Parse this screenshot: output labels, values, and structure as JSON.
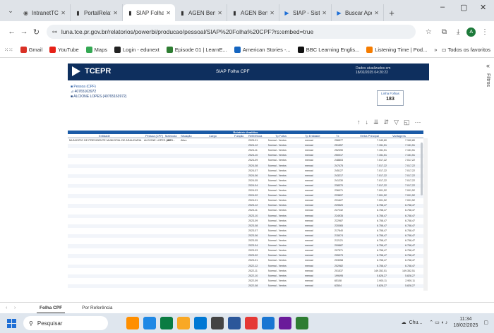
{
  "browser": {
    "tabs": [
      {
        "title": "IntranetTC",
        "icon": "globe-icon",
        "active": false
      },
      {
        "title": "PortalRelatório",
        "icon": "powerbi-icon",
        "active": false
      },
      {
        "title": "SIAP Folha CPF",
        "icon": "powerbi-icon",
        "active": true
      },
      {
        "title": "AGEN Benefício",
        "icon": "powerbi-icon",
        "active": false
      },
      {
        "title": "AGEN Benefício",
        "icon": "powerbi-icon",
        "active": false
      },
      {
        "title": "SIAP - Sistema",
        "icon": "play-icon",
        "active": false
      },
      {
        "title": "Buscar Aposent",
        "icon": "play-icon",
        "active": false
      }
    ],
    "window_controls": {
      "minimize": "–",
      "maximize": "▢",
      "close": "✕"
    },
    "url": "luna.tce.pr.gov.br/relatorios/powerbi/producao/pessoal/SIAP%20Folha%20CPF?rs:embed=true",
    "bookmarks": [
      {
        "label": "Gmail",
        "color": "#d93025"
      },
      {
        "label": "YouTube",
        "color": "#e62117"
      },
      {
        "label": "Maps",
        "color": "#34a853"
      },
      {
        "label": "Login - edunext",
        "color": "#222"
      },
      {
        "label": "Episode 01 | LearnE...",
        "color": "#2e7d32"
      },
      {
        "label": "American Stories -...",
        "color": "#1565c0"
      },
      {
        "label": "BBC Learning Englis...",
        "color": "#111"
      },
      {
        "label": "Listening Time | Pod...",
        "color": "#f57c00"
      }
    ],
    "bookmarks_more": "»",
    "bookmarks_folder": "Todos os favoritos"
  },
  "report": {
    "brand": "TCEPR",
    "title": "SIAP Folha CPF",
    "updated_label": "Dados atualizados em",
    "updated_at": "18/02/2025 04:20:22",
    "filter_pessoa_label": "■ Pessoa (CPF)",
    "filter_cpf_line": "⊿ 40765163972",
    "filter_name_line": "■ ALCIONE LOPES (40765163972)",
    "cpf_box_caption": "Linha Folhas",
    "cpf_box_value": "183",
    "visual_tools": [
      "↑",
      "↓",
      "⇊",
      "⇵",
      "▽",
      "◱",
      "⋯"
    ],
    "table_title": "Relatório Analítico",
    "columns": {
      "entidade": "Entidade",
      "pessoa": "Pessoa (CPF)",
      "matricula": "Matrícula",
      "situacao": "Situação",
      "cargo": "Cargo",
      "funcao": "Função",
      "referencia": "Referência",
      "tipo_folha": "Tp Folha",
      "tipo_entidade": "Tp Entidade",
      "id": "Tx",
      "bruto": "Verba Principal",
      "vantagens": "Vantagens"
    },
    "first_row": {
      "entidade": "MUNICIPIO DE PRESIDENTE MUNICIPAL DE ARAUCARIA",
      "pessoa": "ALCIONE LOPES (4076...",
      "matricula": "153",
      "situacao": "Ativo"
    },
    "rows": [
      {
        "ref": "2025-01",
        "tipo": "Normal - Ventos",
        "tent": "mensal",
        "id": "256577",
        "v1": "7.340,80",
        "v2": "7.340,80"
      },
      {
        "ref": "2024-12",
        "tipo": "Normal - Ventos",
        "tent": "mensal",
        "id": "251557",
        "v1": "7.151,51",
        "v2": "7.151,51"
      },
      {
        "ref": "2024-11",
        "tipo": "Normal - Ventos",
        "tent": "mensal",
        "id": "252390",
        "v1": "7.151,51",
        "v2": "7.151,51"
      },
      {
        "ref": "2024-10",
        "tipo": "Normal - Ventos",
        "tent": "mensal",
        "id": "250017",
        "v1": "7.151,51",
        "v2": "7.151,51"
      },
      {
        "ref": "2024-09",
        "tipo": "Normal - Ventos",
        "tent": "mensal",
        "id": "248803",
        "v1": "7.017,22",
        "v2": "7.017,22"
      },
      {
        "ref": "2024-08",
        "tipo": "Normal - Ventos",
        "tent": "mensal",
        "id": "247475",
        "v1": "7.017,22",
        "v2": "7.017,22"
      },
      {
        "ref": "2024-07",
        "tipo": "Normal - Ventos",
        "tent": "mensal",
        "id": "245127",
        "v1": "7.017,22",
        "v2": "7.017,22"
      },
      {
        "ref": "2024-06",
        "tipo": "Normal - Ventos",
        "tent": "mensal",
        "id": "243217",
        "v1": "7.017,22",
        "v2": "7.017,22"
      },
      {
        "ref": "2024-05",
        "tipo": "Normal - Ventos",
        "tent": "mensal",
        "id": "241230",
        "v1": "7.017,22",
        "v2": "7.017,22"
      },
      {
        "ref": "2024-04",
        "tipo": "Normal - Ventos",
        "tent": "mensal",
        "id": "238370",
        "v1": "7.017,22",
        "v2": "7.017,22"
      },
      {
        "ref": "2024-03",
        "tipo": "Normal - Ventos",
        "tent": "mensal",
        "id": "236071",
        "v1": "7.001,52",
        "v2": "7.001,52"
      },
      {
        "ref": "2024-02",
        "tipo": "Normal - Ventos",
        "tent": "mensal",
        "id": "233897",
        "v1": "7.001,52",
        "v2": "7.001,52"
      },
      {
        "ref": "2024-01",
        "tipo": "Normal - Ventos",
        "tent": "mensal",
        "id": "231627",
        "v1": "7.001,52",
        "v2": "7.001,52"
      },
      {
        "ref": "2023-12",
        "tipo": "Normal - Ventos",
        "tent": "mensal",
        "id": "229520",
        "v1": "6.758,47",
        "v2": "6.758,47"
      },
      {
        "ref": "2023-11",
        "tipo": "Normal - Ventos",
        "tent": "mensal",
        "id": "227232",
        "v1": "6.758,47",
        "v2": "6.758,47"
      },
      {
        "ref": "2023-10",
        "tipo": "Normal - Ventos",
        "tent": "mensal",
        "id": "224935",
        "v1": "6.758,47",
        "v2": "6.758,47"
      },
      {
        "ref": "2023-09",
        "tipo": "Normal - Ventos",
        "tent": "mensal",
        "id": "222987",
        "v1": "6.758,47",
        "v2": "6.758,47"
      },
      {
        "ref": "2023-08",
        "tipo": "Normal - Ventos",
        "tent": "mensal",
        "id": "220065",
        "v1": "6.758,47",
        "v2": "6.758,47"
      },
      {
        "ref": "2023-07",
        "tipo": "Normal - Ventos",
        "tent": "mensal",
        "id": "217640",
        "v1": "6.758,47",
        "v2": "6.758,47"
      },
      {
        "ref": "2023-06",
        "tipo": "Normal - Ventos",
        "tent": "mensal",
        "id": "215074",
        "v1": "6.758,47",
        "v2": "6.758,47"
      },
      {
        "ref": "2023-05",
        "tipo": "Normal - Ventos",
        "tent": "mensal",
        "id": "212121",
        "v1": "6.758,47",
        "v2": "6.758,47"
      },
      {
        "ref": "2023-04",
        "tipo": "Normal - Ventos",
        "tent": "mensal",
        "id": "209887",
        "v1": "6.758,47",
        "v2": "6.758,47"
      },
      {
        "ref": "2023-03",
        "tipo": "Normal - Ventos",
        "tent": "mensal",
        "id": "207571",
        "v1": "6.758,47",
        "v2": "6.758,47"
      },
      {
        "ref": "2023-02",
        "tipo": "Normal - Ventos",
        "tent": "mensal",
        "id": "205379",
        "v1": "6.758,47",
        "v2": "6.758,47"
      },
      {
        "ref": "2023-01",
        "tipo": "Normal - Ventos",
        "tent": "mensal",
        "id": "203058",
        "v1": "6.758,47",
        "v2": "6.758,47"
      },
      {
        "ref": "2022-12",
        "tipo": "Normal - Ventos",
        "tent": "mensal",
        "id": "202982",
        "v1": "6.758,47",
        "v2": "6.758,47"
      },
      {
        "ref": "2022-11",
        "tipo": "Normal - Ventos",
        "tent": "mensal",
        "id": "201537",
        "v1": "149.352,51",
        "v2": "149.352,51"
      },
      {
        "ref": "2022-10",
        "tipo": "Normal - Ventos",
        "tent": "mensal",
        "id": "199495",
        "v1": "5.828,27",
        "v2": "5.828,27"
      },
      {
        "ref": "2022-09",
        "tipo": "Normal - Ventos",
        "tent": "mensal",
        "id": "65108",
        "v1": "2.900,11",
        "v2": "2.900,11"
      },
      {
        "ref": "2022-08",
        "tipo": "Normal - Ventos",
        "tent": "mensal",
        "id": "63504",
        "v1": "5.828,27",
        "v2": "5.828,27"
      }
    ],
    "side_panel_label": "Filtros"
  },
  "page_tabs": [
    "Folha CPF",
    "Por Referência"
  ],
  "taskbar": {
    "search_placeholder": "Pesquisar",
    "tray_label": "Chu...",
    "time": "11:34",
    "date": "18/02/2025",
    "apps": [
      "#ff8f00",
      "#1e88e5",
      "#0a7c42",
      "#f9a825",
      "#0078d4",
      "#444",
      "#2b579a",
      "#e53935",
      "#1976d2",
      "#6a1b9a",
      "#2e7d32"
    ]
  }
}
